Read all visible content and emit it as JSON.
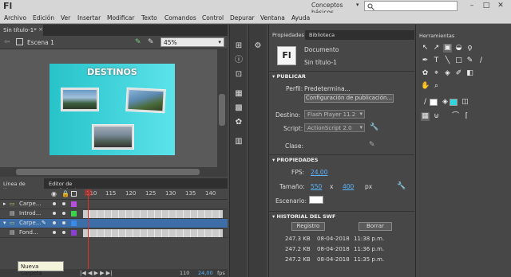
{
  "app": {
    "logo": "Fl",
    "workspace": "Conceptos básicos",
    "workspace_arrow": "▾"
  },
  "menu": [
    "Archivo",
    "Edición",
    "Ver",
    "Insertar",
    "Modificar",
    "Texto",
    "Comandos",
    "Control",
    "Depurar",
    "Ventana",
    "Ayuda"
  ],
  "document": {
    "tab": "Sin título-1*",
    "scene": "Escena 1",
    "zoom": "45%"
  },
  "stage": {
    "title": "DESTINOS",
    "bg_color": "#33cbd2"
  },
  "timeline": {
    "tabs": [
      "Línea de tiempo",
      "Editor de movimiento"
    ],
    "frames": [
      "110",
      "115",
      "120",
      "125",
      "130",
      "135",
      "140"
    ],
    "layers": [
      {
        "name": "Carpe...",
        "color": "#b64fe0"
      },
      {
        "name": "Introd...",
        "color": "#3cd24a"
      },
      {
        "name": "Carpe...",
        "color": "#3a8be8"
      },
      {
        "name": "Fond...",
        "color": "#8d3fd2"
      }
    ],
    "tooltip": "Nueva carpeta",
    "status": [
      "110",
      "24,00",
      "fps"
    ]
  },
  "properties": {
    "tabs": [
      "Propiedades",
      "Biblioteca"
    ],
    "doc_type": "Documento",
    "doc_name": "Sin título-1",
    "doc_icon": "Fl",
    "publish": {
      "header": "PUBLICAR",
      "profile_label": "Perfil:",
      "profile_value": "Predetermina...",
      "config_button": "Configuración de publicación...",
      "target_label": "Destino:",
      "target_value": "Flash Player 11.2",
      "script_label": "Script:",
      "script_value": "ActionScript 2.0",
      "class_label": "Clase:"
    },
    "props": {
      "header": "PROPIEDADES",
      "fps_label": "FPS:",
      "fps_value": "24,00",
      "size_label": "Tamaño:",
      "width": "550",
      "x": "x",
      "height": "400",
      "unit": "px",
      "stage_label": "Escenario:"
    },
    "history": {
      "header": "HISTORIAL DEL SWF",
      "log_button": "Registro",
      "clear_button": "Borrar",
      "entries": [
        {
          "size": "247.3 KB",
          "date": "08-04-2018",
          "time": "11:38 p.m."
        },
        {
          "size": "247.2 KB",
          "date": "08-04-2018",
          "time": "11:36 p.m."
        },
        {
          "size": "247.2 KB",
          "date": "08-04-2018",
          "time": "11:35 p.m."
        }
      ]
    }
  },
  "tools_panel": {
    "title": "Herramientas"
  }
}
